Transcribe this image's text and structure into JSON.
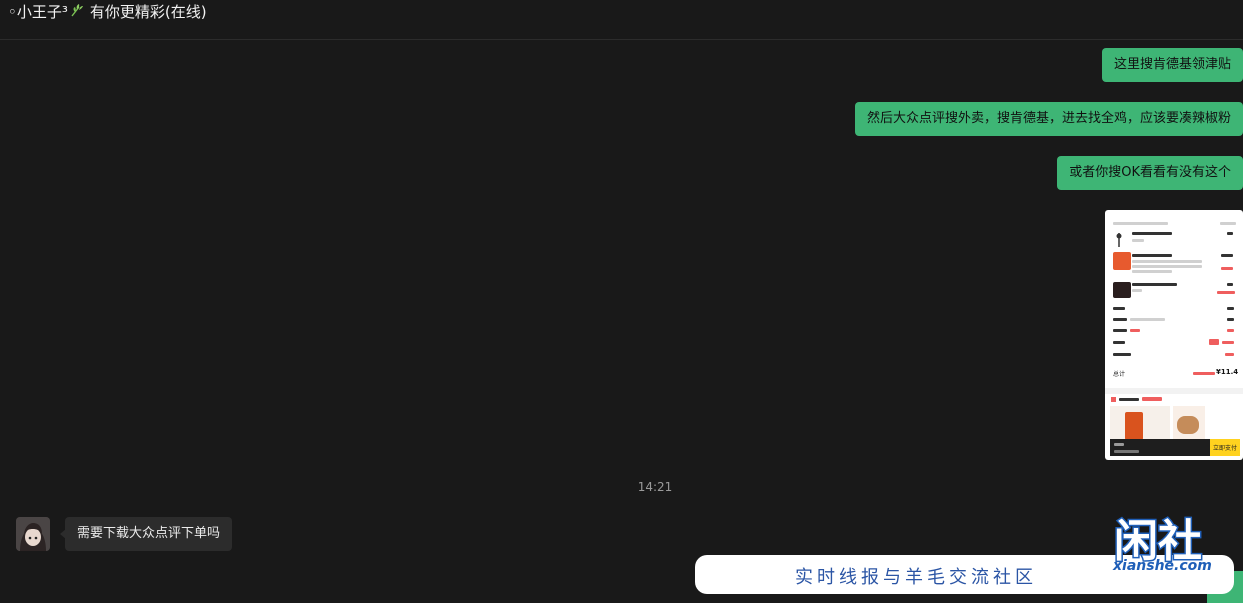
{
  "chat": {
    "title_name": "◦小王子³",
    "title_status": "有你更精彩(在线)",
    "sprout_icon": "sprout-icon"
  },
  "messages_out": [
    {
      "text": "这里搜肯德基领津贴"
    },
    {
      "text": "然后大众点评搜外卖，搜肯德基，进去找全鸡，应该要凑辣椒粉"
    },
    {
      "text": "或者你搜OK看看有没有这个"
    }
  ],
  "image_message": {
    "total_label": "总计",
    "total_value": "¥11.4",
    "pay_button": "立即支付"
  },
  "timestamp": "14:21",
  "message_in": {
    "text": "需要下载大众点评下单吗"
  },
  "watermark": {
    "slogan": "实时线报与羊毛交流社区",
    "logo": "闲社",
    "domain": "xianshe.com"
  },
  "colors": {
    "background": "#191919",
    "bubble_out": "#3eb575",
    "bubble_in": "#2c2c2c",
    "watermark_blue": "#2b55a5"
  }
}
